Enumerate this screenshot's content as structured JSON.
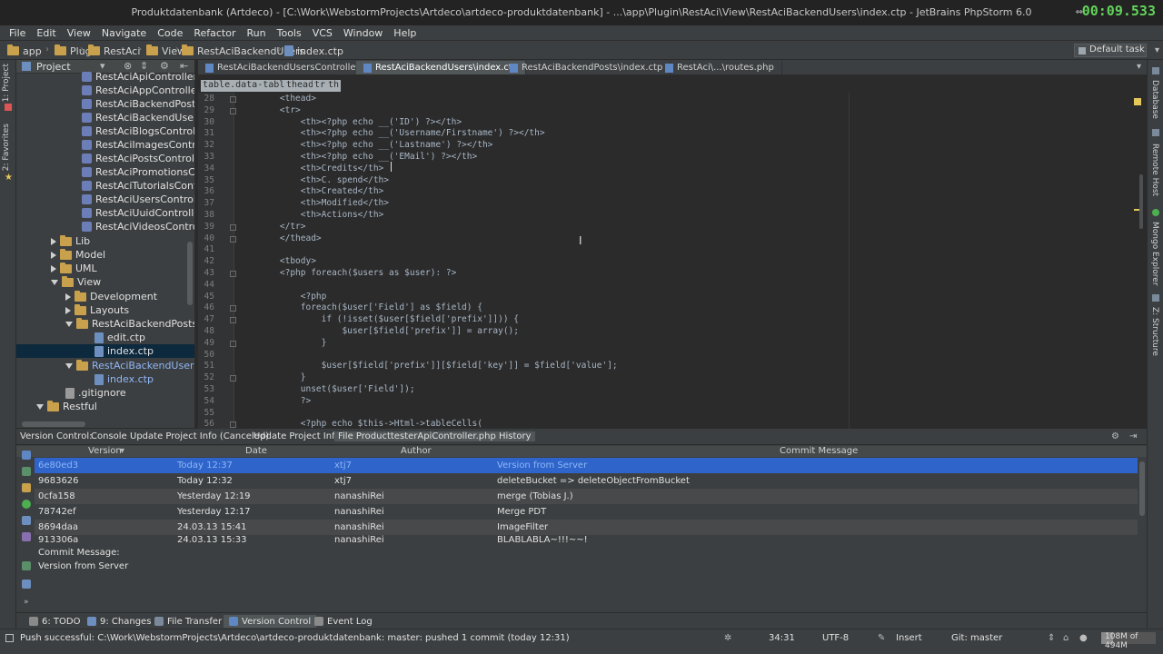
{
  "window": {
    "title": "Produktdatenbank (Artdeco) - [C:\\Work\\WebstormProjects\\Artdeco\\artdeco-produktdatenbank] - ...\\app\\Plugin\\RestAci\\View\\RestAciBackendUsers\\index.ctp - JetBrains PhpStorm 6.0",
    "timer": "00:09.533",
    "restore_icon": "restore-window-icon"
  },
  "menu": [
    "File",
    "Edit",
    "View",
    "Navigate",
    "Code",
    "Refactor",
    "Run",
    "Tools",
    "VCS",
    "Window",
    "Help"
  ],
  "breadcrumbs": [
    "app",
    "Plugin",
    "RestAci",
    "View",
    "RestAciBackendUsers",
    "index.ctp"
  ],
  "run_config": "Default task",
  "left_strip": {
    "project": "1: Project",
    "favorites": "2: Favorites"
  },
  "right_strip": {
    "database": "Database",
    "remote_host": "Remote Host",
    "mongo": "Mongo Explorer",
    "structure": "Z: Structure"
  },
  "project_panel": {
    "title": "Project",
    "items": [
      {
        "label": "RestAciApiController.p",
        "kind": "php"
      },
      {
        "label": "RestAciAppController.",
        "kind": "php"
      },
      {
        "label": "RestAciBackendPostsC",
        "kind": "php"
      },
      {
        "label": "RestAciBackendUsersC",
        "kind": "php"
      },
      {
        "label": "RestAciBlogsControlle",
        "kind": "php"
      },
      {
        "label": "RestAciImagesControl",
        "kind": "php"
      },
      {
        "label": "RestAciPostsControlle",
        "kind": "php"
      },
      {
        "label": "RestAciPromotionsCo",
        "kind": "php"
      },
      {
        "label": "RestAciTutorialsContr",
        "kind": "php"
      },
      {
        "label": "RestAciUsersControlle",
        "kind": "php"
      },
      {
        "label": "RestAciUuidController",
        "kind": "php"
      },
      {
        "label": "RestAciVideosControll",
        "kind": "php"
      },
      {
        "label": "Lib",
        "kind": "folder"
      },
      {
        "label": "Model",
        "kind": "folder"
      },
      {
        "label": "UML",
        "kind": "folder"
      },
      {
        "label": "View",
        "kind": "folder"
      },
      {
        "label": "Development",
        "kind": "folder"
      },
      {
        "label": "Layouts",
        "kind": "folder"
      },
      {
        "label": "RestAciBackendPosts",
        "kind": "folder"
      },
      {
        "label": "edit.ctp",
        "kind": "file"
      },
      {
        "label": "index.ctp",
        "kind": "file"
      },
      {
        "label": "RestAciBackendUsers",
        "kind": "folder"
      },
      {
        "label": "index.ctp",
        "kind": "file"
      },
      {
        "label": ".gitignore",
        "kind": "file"
      },
      {
        "label": "Restful",
        "kind": "folder"
      }
    ]
  },
  "editor_tabs": [
    {
      "label": "RestAciBackendUsersController.php",
      "active": false
    },
    {
      "label": "RestAciBackendUsers\\index.ctp",
      "active": true
    },
    {
      "label": "RestAciBackendPosts\\index.ctp",
      "active": false
    },
    {
      "label": "RestAci\\...\\routes.php",
      "active": false
    }
  ],
  "code_breadcrumb": [
    "table.data-table",
    "thead",
    "tr",
    "th"
  ],
  "code_lines": [
    {
      "n": "28",
      "text": "    <thead>"
    },
    {
      "n": "29",
      "text": "    <tr>"
    },
    {
      "n": "30",
      "text": "        <th><?php echo __('ID') ?></th>"
    },
    {
      "n": "31",
      "text": "        <th><?php echo __('Username/Firstname') ?></th>"
    },
    {
      "n": "32",
      "text": "        <th><?php echo __('Lastname') ?></th>"
    },
    {
      "n": "33",
      "text": "        <th><?php echo __('EMail') ?></th>"
    },
    {
      "n": "34",
      "text": "        <th>Credits</th>"
    },
    {
      "n": "35",
      "text": "        <th>C. spend</th>"
    },
    {
      "n": "36",
      "text": "        <th>Created</th>"
    },
    {
      "n": "37",
      "text": "        <th>Modified</th>"
    },
    {
      "n": "38",
      "text": "        <th>Actions</th>"
    },
    {
      "n": "39",
      "text": "    </tr>"
    },
    {
      "n": "40",
      "text": "    </thead>"
    },
    {
      "n": "41",
      "text": ""
    },
    {
      "n": "42",
      "text": "    <tbody>"
    },
    {
      "n": "43",
      "text": "    <?php foreach($users as $user): ?>"
    },
    {
      "n": "44",
      "text": ""
    },
    {
      "n": "45",
      "text": "        <?php"
    },
    {
      "n": "46",
      "text": "        foreach($user['Field'] as $field) {"
    },
    {
      "n": "47",
      "text": "            if (!isset($user[$field['prefix']])) {"
    },
    {
      "n": "48",
      "text": "                $user[$field['prefix']] = array();"
    },
    {
      "n": "49",
      "text": "            }"
    },
    {
      "n": "50",
      "text": ""
    },
    {
      "n": "51",
      "text": "            $user[$field['prefix']][$field['key']] = $field['value'];"
    },
    {
      "n": "52",
      "text": "        }"
    },
    {
      "n": "53",
      "text": "        unset($user['Field']);"
    },
    {
      "n": "54",
      "text": "        ?>"
    },
    {
      "n": "55",
      "text": ""
    },
    {
      "n": "56",
      "text": "        <?php echo $this->Html->tableCells("
    }
  ],
  "vcs_panel": {
    "label": "Version Control:",
    "tabs": [
      "Console",
      "Update Project Info (Canceled)",
      "Update Project Info",
      "File ProducttesterApiController.php History"
    ],
    "columns": {
      "version": "Version",
      "date": "Date",
      "author": "Author",
      "message": "Commit Message"
    },
    "rows": [
      {
        "version": "6e80ed3",
        "date": "Today 12:37",
        "author": "xtj7",
        "message": "Version from Server"
      },
      {
        "version": "9683626",
        "date": "Today 12:32",
        "author": "xtj7",
        "message": "deleteBucket => deleteObjectFromBucket"
      },
      {
        "version": "0cfa158",
        "date": "Yesterday 12:19",
        "author": "nanashiRei",
        "message": "merge (Tobias J.)"
      },
      {
        "version": "78742ef",
        "date": "Yesterday 12:17",
        "author": "nanashiRei",
        "message": "Merge PDT"
      },
      {
        "version": "8694daa",
        "date": "24.03.13 15:41",
        "author": "nanashiRei",
        "message": "ImageFilter"
      },
      {
        "version": "913306a",
        "date": "24.03.13 15:33",
        "author": "nanashiRei",
        "message": "BLABLABLA~!!!~~!"
      }
    ],
    "commit_label": "Commit Message:",
    "commit_text": "Version from Server"
  },
  "tool_tabs": [
    {
      "label": "6: TODO",
      "active": false
    },
    {
      "label": "9: Changes",
      "active": false
    },
    {
      "label": "File Transfer",
      "active": false
    },
    {
      "label": "Version Control",
      "active": true
    },
    {
      "label": "Event Log",
      "active": false
    }
  ],
  "status": {
    "message": "Push successful: C:\\Work\\WebstormProjects\\Artdeco\\artdeco-produktdatenbank: master: pushed 1 commit (today 12:31)",
    "position": "34:31",
    "encoding": "UTF-8",
    "insert": "Insert",
    "git": "Git: master",
    "memory": "108M of 494M",
    "memory_fraction": 0.22
  },
  "colors": {
    "accent_selection": "#2f65ca",
    "timer": "#63d35b"
  }
}
